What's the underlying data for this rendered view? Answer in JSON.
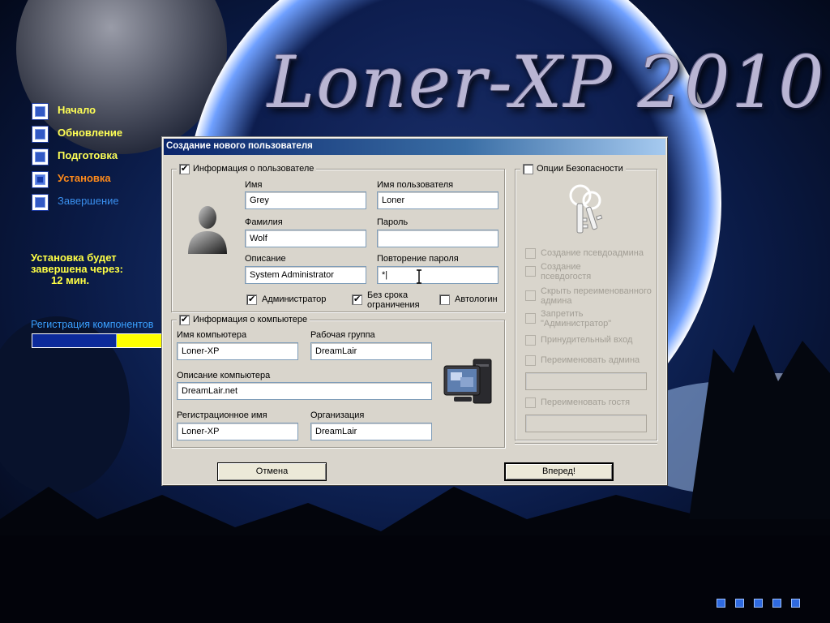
{
  "brand": {
    "title": "Loner-XP 2010"
  },
  "steps": [
    {
      "label": "Начало",
      "state": "done"
    },
    {
      "label": "Обновление",
      "state": "done"
    },
    {
      "label": "Подготовка",
      "state": "done"
    },
    {
      "label": "Установка",
      "state": "active"
    },
    {
      "label": "Завершение",
      "state": "future"
    }
  ],
  "remaining": {
    "line1": "Установка будет",
    "line2": "завершена через:",
    "minutes": "12 мин."
  },
  "progress": {
    "label": "Регистрация компонентов",
    "fraction": 0.6
  },
  "dialog": {
    "title": "Создание нового пользователя",
    "user_group": {
      "legend": "Информация о пользователе",
      "checked": true,
      "first_name": {
        "label": "Имя",
        "value": "Grey"
      },
      "username": {
        "label": "Имя пользователя",
        "value": "Loner"
      },
      "last_name": {
        "label": "Фамилия",
        "value": "Wolf"
      },
      "password": {
        "label": "Пароль",
        "value": ""
      },
      "description": {
        "label": "Описание",
        "value": "System Administrator"
      },
      "password_repeat": {
        "label": "Повторение пароля",
        "value": "*|"
      },
      "admin": {
        "label": "Администратор",
        "checked": true
      },
      "no_expiry": {
        "label_line1": "Без срока",
        "label_line2": "ограничения",
        "checked": true
      },
      "autologon": {
        "label": "Автологин",
        "checked": false
      }
    },
    "computer_group": {
      "legend": "Информация о компьютере",
      "checked": true,
      "computer_name": {
        "label": "Имя компьютера",
        "value": "Loner-XP"
      },
      "workgroup": {
        "label": "Рабочая группа",
        "value": "DreamLair"
      },
      "computer_desc": {
        "label": "Описание компьютера",
        "value": "DreamLair.net"
      },
      "reg_name": {
        "label": "Регистрационное имя",
        "value": "Loner-XP"
      },
      "organization": {
        "label": "Организация",
        "value": "DreamLair"
      }
    },
    "security_group": {
      "legend": "Опции Безопасности",
      "checked": false,
      "options": [
        {
          "line1": "Создание псевдоадмина",
          "line2": ""
        },
        {
          "line1": "Создание",
          "line2": "псевдогостя"
        },
        {
          "line1": "Скрыть переименованного",
          "line2": "админа"
        },
        {
          "line1": "Запретить",
          "line2": "\"Администратор\""
        },
        {
          "line1": "Принудительный вход",
          "line2": ""
        },
        {
          "line1": "Переименовать админа",
          "line2": ""
        },
        {
          "line1": "Переименовать гостя",
          "line2": ""
        }
      ],
      "rename_admin_value": "",
      "rename_guest_value": ""
    },
    "cancel_label": "Отмена",
    "next_label": "Вперед!"
  },
  "colors": {
    "step_done": "#ffff55",
    "step_active": "#ff8a1a",
    "step_future": "#3a8fee",
    "progress_fill": "#0c2a9a",
    "progress_track": "#ffff00"
  },
  "icons": [
    "user-silhouette-icon",
    "keys-icon",
    "computer-monitor-icon",
    "checkbox-icon",
    "step-square-icon"
  ]
}
